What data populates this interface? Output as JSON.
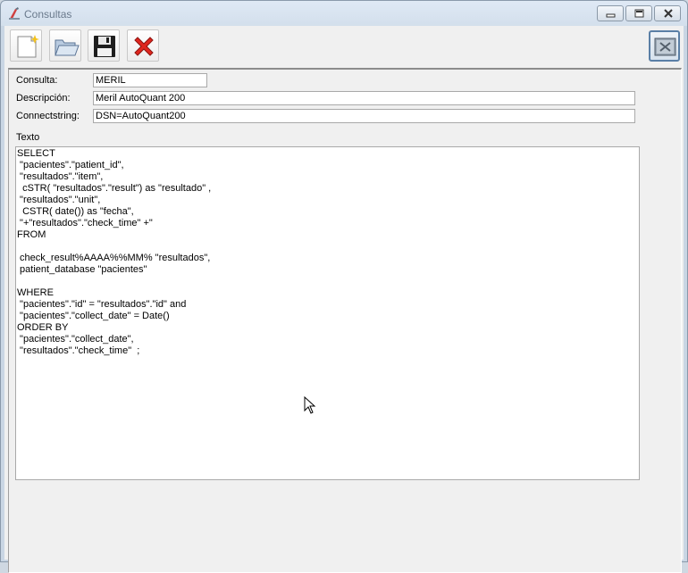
{
  "window": {
    "title": "Consultas"
  },
  "titlebar": {
    "buttons": [
      "minimize",
      "maximize",
      "close"
    ]
  },
  "toolbar": {
    "buttons": [
      {
        "icon": "new-document-icon"
      },
      {
        "icon": "open-folder-icon"
      },
      {
        "icon": "save-disk-icon"
      },
      {
        "icon": "delete-x-icon"
      }
    ],
    "exit_icon": "exit-icon"
  },
  "form": {
    "consulta_label": "Consulta:",
    "consulta_value": "MERIL",
    "descripcion_label": "Descripción:",
    "descripcion_value": "Meril AutoQuant 200",
    "connect_label": "Connectstring:",
    "connect_value": "DSN=AutoQuant200",
    "texto_label": "Texto",
    "texto_value": "SELECT\n \"pacientes\".\"patient_id\",\n \"resultados\".\"item\",\n  cSTR( \"resultados\".\"result\") as \"resultado\" ,\n \"resultados\".\"unit\",\n  CSTR( date()) as \"fecha\",\n \"+\"resultados\".\"check_time\" +\"\nFROM\n\n check_result%AAAA%%MM% \"resultados\",\n patient_database \"pacientes\"\n\nWHERE\n \"pacientes\".\"id\" = \"resultados\".\"id\" and\n \"pacientes\".\"collect_date\" = Date()\nORDER BY\n \"pacientes\".\"collect_date\",\n \"resultados\".\"check_time\"  ;"
  }
}
